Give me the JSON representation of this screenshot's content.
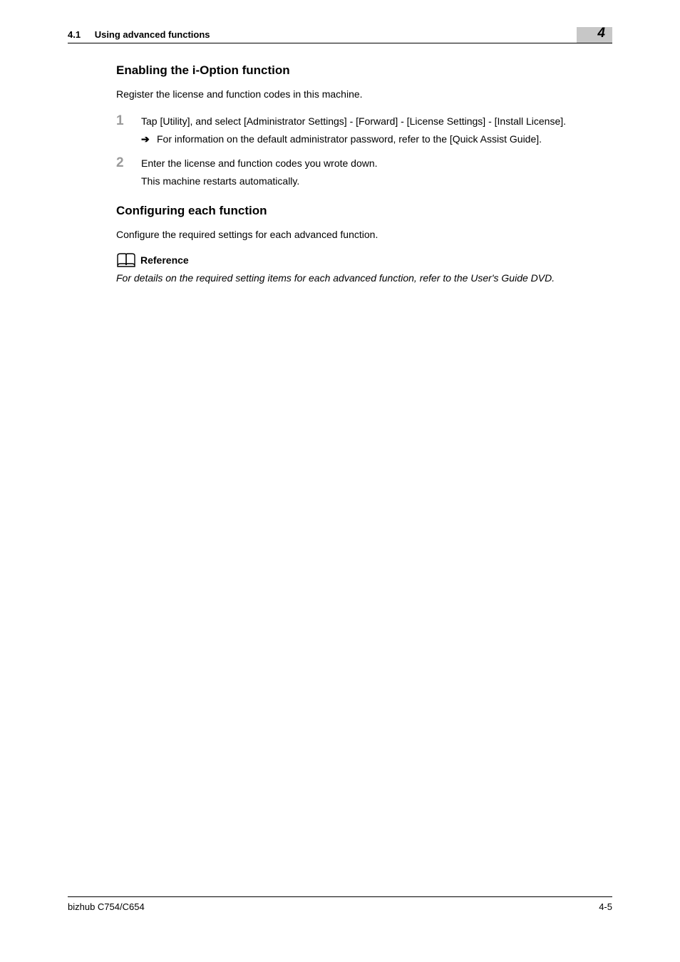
{
  "header": {
    "section_number": "4.1",
    "section_title": "Using advanced functions",
    "chapter": "4"
  },
  "content": {
    "heading1": "Enabling the i-Option function",
    "intro1": "Register the license and function codes in this machine.",
    "step1": {
      "num": "1",
      "text": "Tap [Utility], and select [Administrator Settings] - [Forward] - [License Settings] - [Install License].",
      "sub_arrow": "➔",
      "sub_text": "For information on the default administrator password, refer to the [Quick Assist Guide]."
    },
    "step2": {
      "num": "2",
      "text": "Enter the license and function codes you wrote down.",
      "note": "This machine restarts automatically."
    },
    "heading2": "Configuring each function",
    "intro2": "Configure the required settings for each advanced function.",
    "reference": {
      "label": "Reference",
      "text": "For details on the required setting items for each advanced function, refer to the User's Guide DVD."
    }
  },
  "footer": {
    "model": "bizhub C754/C654",
    "page": "4-5"
  }
}
